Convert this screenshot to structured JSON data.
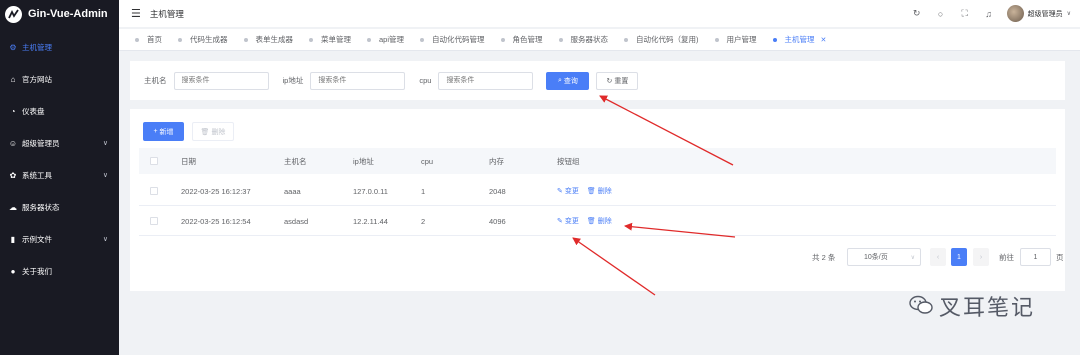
{
  "app": {
    "title": "Gin-Vue-Admin"
  },
  "sidebar": {
    "items": [
      {
        "label": "主机管理",
        "icon": "gear-icon",
        "active": true,
        "expandable": false
      },
      {
        "label": "官方网站",
        "icon": "home-icon",
        "active": false,
        "expandable": false
      },
      {
        "label": "仪表盘",
        "icon": "dashboard-icon",
        "active": false,
        "expandable": false
      },
      {
        "label": "超级管理员",
        "icon": "user-icon",
        "active": false,
        "expandable": true
      },
      {
        "label": "系统工具",
        "icon": "gear-icon",
        "active": false,
        "expandable": true
      },
      {
        "label": "服务器状态",
        "icon": "cloud-icon",
        "active": false,
        "expandable": false
      },
      {
        "label": "示例文件",
        "icon": "folder-icon",
        "active": false,
        "expandable": true
      },
      {
        "label": "关于我们",
        "icon": "info-icon",
        "active": false,
        "expandable": false
      }
    ]
  },
  "header": {
    "breadcrumb": "主机管理",
    "username": "超级管理员"
  },
  "tabs": [
    {
      "label": "首页",
      "active": false
    },
    {
      "label": "代码生成器",
      "active": false
    },
    {
      "label": "表单生成器",
      "active": false
    },
    {
      "label": "菜单管理",
      "active": false
    },
    {
      "label": "api管理",
      "active": false
    },
    {
      "label": "自动化代码管理",
      "active": false
    },
    {
      "label": "角色管理",
      "active": false
    },
    {
      "label": "服务器状态",
      "active": false
    },
    {
      "label": "自动化代码（复用)",
      "active": false
    },
    {
      "label": "用户管理",
      "active": false
    },
    {
      "label": "主机管理",
      "active": true,
      "closable": true
    }
  ],
  "search": {
    "host_label": "主机名",
    "ip_label": "ip地址",
    "cpu_label": "cpu",
    "placeholder": "搜索条件",
    "query_button": "查询",
    "reset_button": "重置"
  },
  "toolbar": {
    "add_button": "新增",
    "delete_button": "删除"
  },
  "table": {
    "columns": [
      "日期",
      "主机名",
      "ip地址",
      "cpu",
      "内存",
      "按钮组"
    ],
    "rows": [
      {
        "date": "2022-03-25 16:12:37",
        "host": "aaaa",
        "ip": "127.0.0.11",
        "cpu": "1",
        "memory": "2048"
      },
      {
        "date": "2022-03-25 16:12:54",
        "host": "asdasd",
        "ip": "12.2.11.44",
        "cpu": "2",
        "memory": "4096"
      }
    ],
    "edit_label": "变更",
    "delete_label": "删除"
  },
  "pagination": {
    "total": "共 2 条",
    "page_size": "10条/页",
    "current_page": "1",
    "goto_label": "前往",
    "jump_value": "1",
    "page_suffix": "页"
  },
  "watermark": {
    "text": "叉耳笔记"
  },
  "colors": {
    "accent": "#4a7ef7",
    "sidebar_bg": "#191a23",
    "annotation_red": "#e02a2a"
  }
}
